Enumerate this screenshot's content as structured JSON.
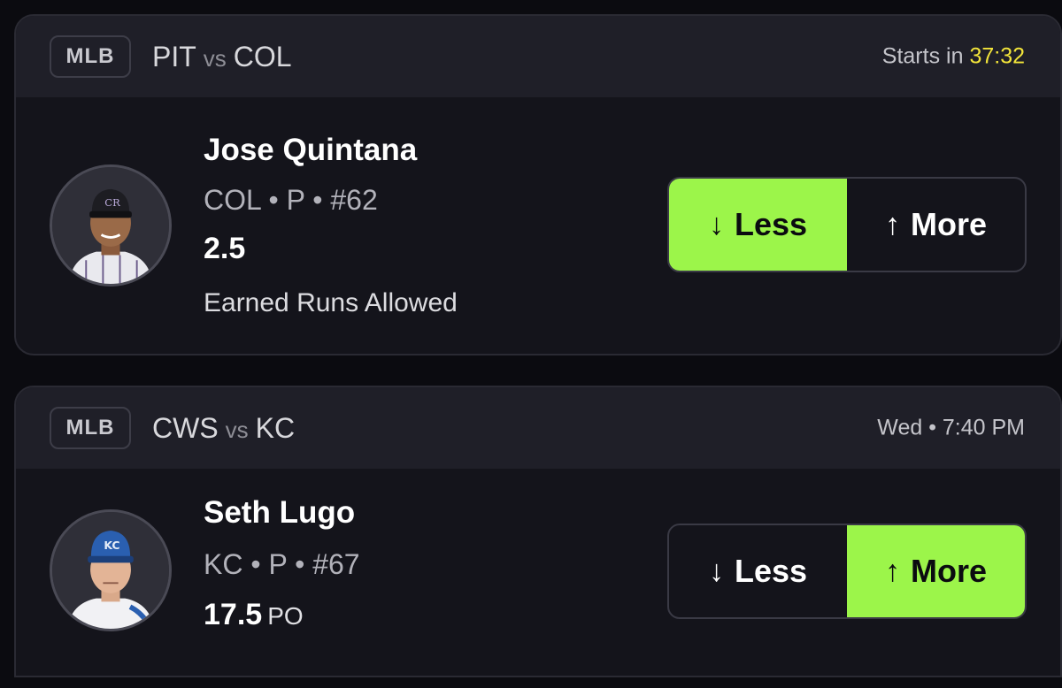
{
  "picks": [
    {
      "league": "MLB",
      "home_team": "PIT",
      "vs": "vs",
      "away_team": "COL",
      "time_label": "Starts in",
      "time_value": "37:32",
      "player_name": "Jose Quintana",
      "player_meta": "COL • P • #62",
      "line": "2.5",
      "unit": "",
      "stat": "Earned Runs Allowed",
      "less_label": "Less",
      "more_label": "More",
      "less_icon": "arrow-down-icon",
      "more_icon": "arrow-up-icon",
      "selected": "less",
      "cap_color": "#1d1d22"
    },
    {
      "league": "MLB",
      "home_team": "CWS",
      "vs": "vs",
      "away_team": "KC",
      "time_label": "Wed • 7:40 PM",
      "time_value": "",
      "player_name": "Seth Lugo",
      "player_meta": "KC • P • #67",
      "line": "17.5",
      "unit": "PO",
      "stat": "",
      "less_label": "Less",
      "more_label": "More",
      "less_icon": "arrow-down-icon",
      "more_icon": "arrow-up-icon",
      "selected": "more",
      "cap_color": "#2a5fb0"
    }
  ],
  "colors": {
    "accent_selected": "#9cf54a",
    "countdown": "#f2e43a",
    "card_bg": "#14141b",
    "header_bg": "#1f1f28"
  }
}
